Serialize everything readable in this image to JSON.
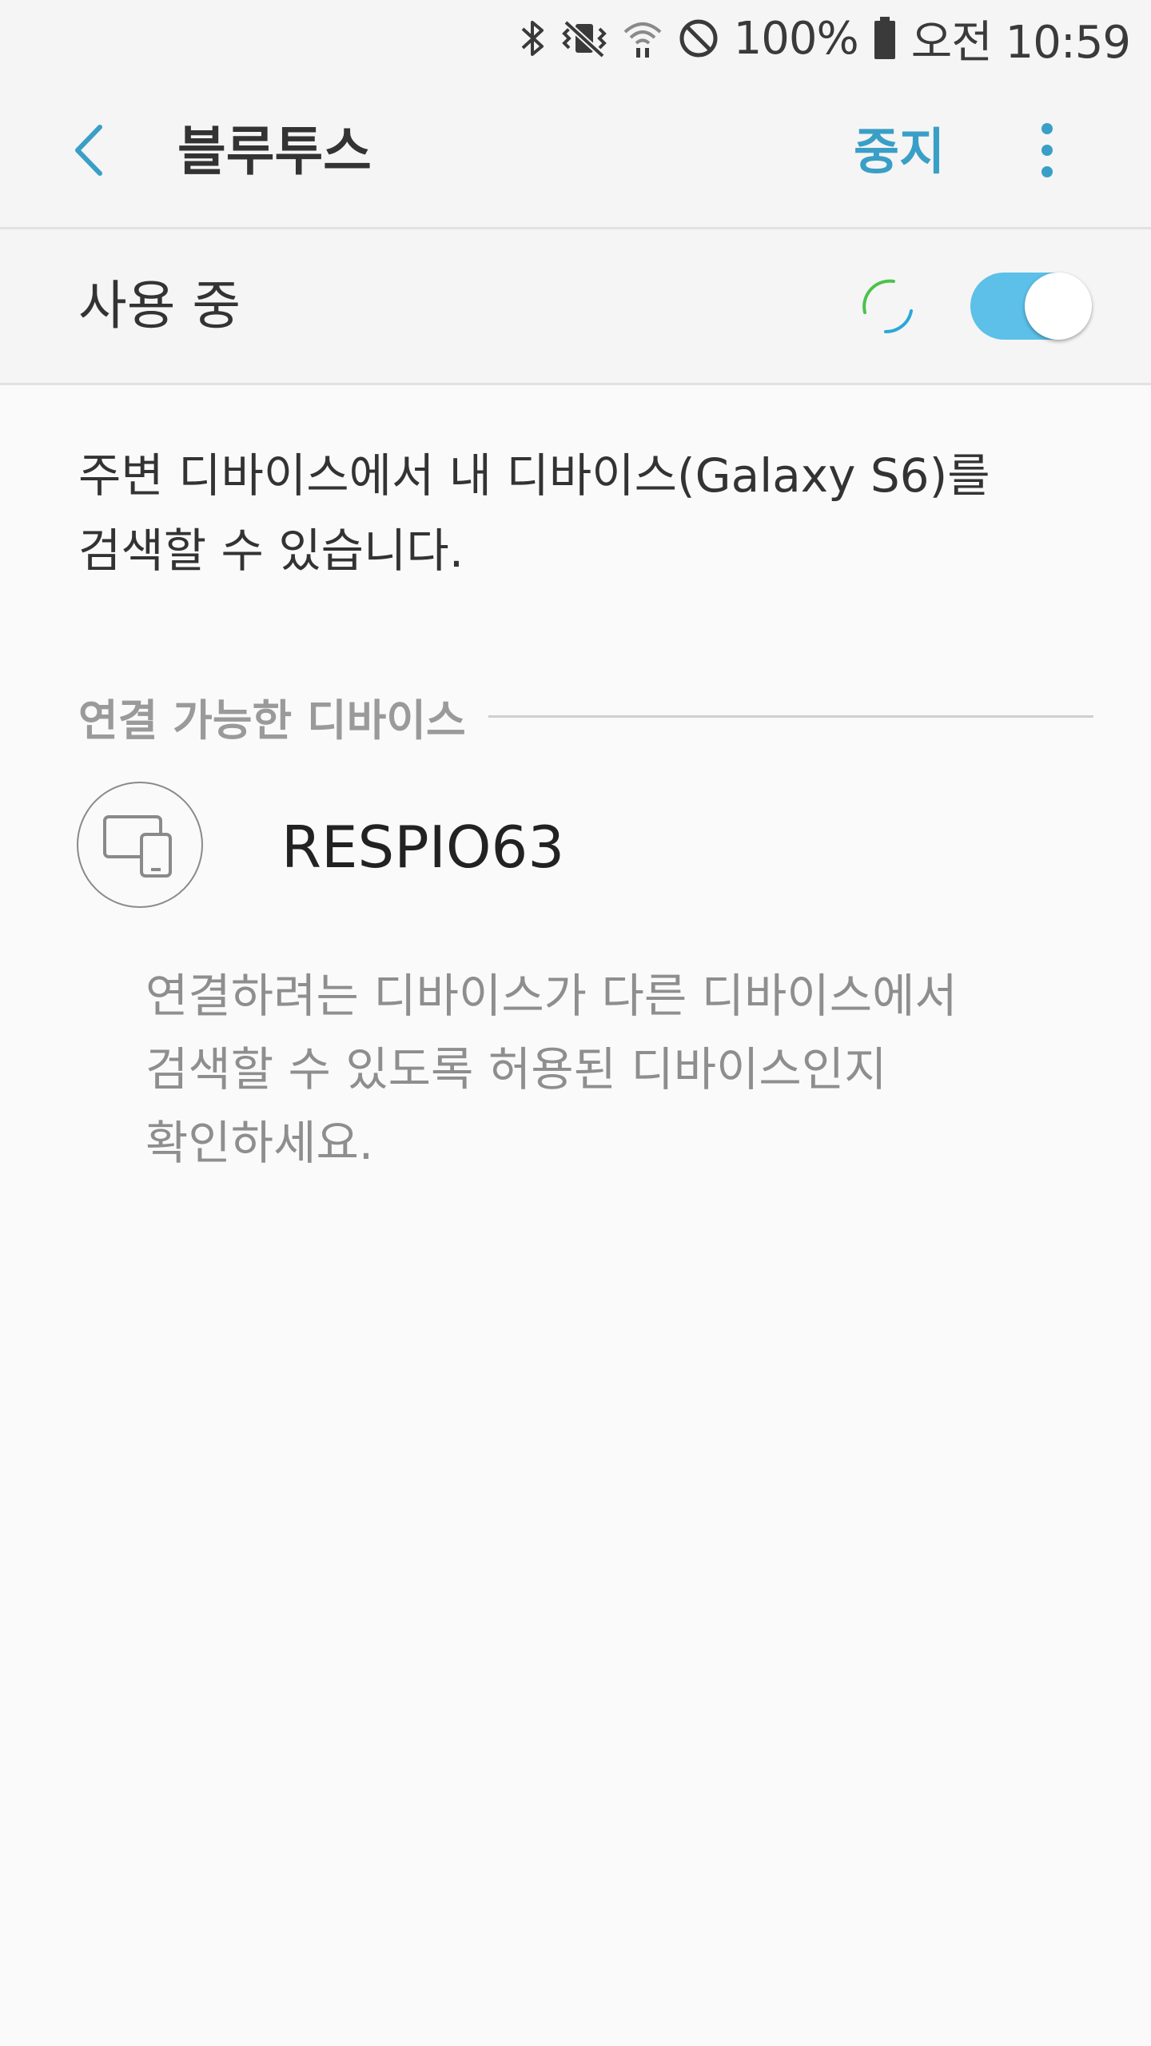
{
  "status_bar": {
    "icons": [
      "bluetooth-icon",
      "vibrate-icon",
      "wifi-icon",
      "do-not-disturb-icon",
      "battery-icon"
    ],
    "battery": "100%",
    "time": "오전 10:59"
  },
  "app_bar": {
    "title": "블루투스",
    "stop_label": "중지",
    "back_icon": "back-arrow-icon",
    "more_icon": "more-vert-icon",
    "accent_color": "#3a9fc7"
  },
  "master_switch": {
    "label": "사용 중",
    "enabled": true,
    "scanning": true,
    "track_color": "#5cc0e8"
  },
  "description": {
    "line1": "주변 디바이스에서 내 디바이스(Galaxy S6)를",
    "line2": "검색할 수 있습니다."
  },
  "available_section": {
    "title": "연결 가능한 디바이스",
    "devices": [
      {
        "name": "RESPIO63",
        "icon": "tablet-phone-icon"
      }
    ],
    "help": {
      "line1": "연결하려는 디바이스가 다른 디바이스에서",
      "line2": "검색할 수 있도록 허용된 디바이스인지",
      "line3": "확인하세요."
    }
  }
}
